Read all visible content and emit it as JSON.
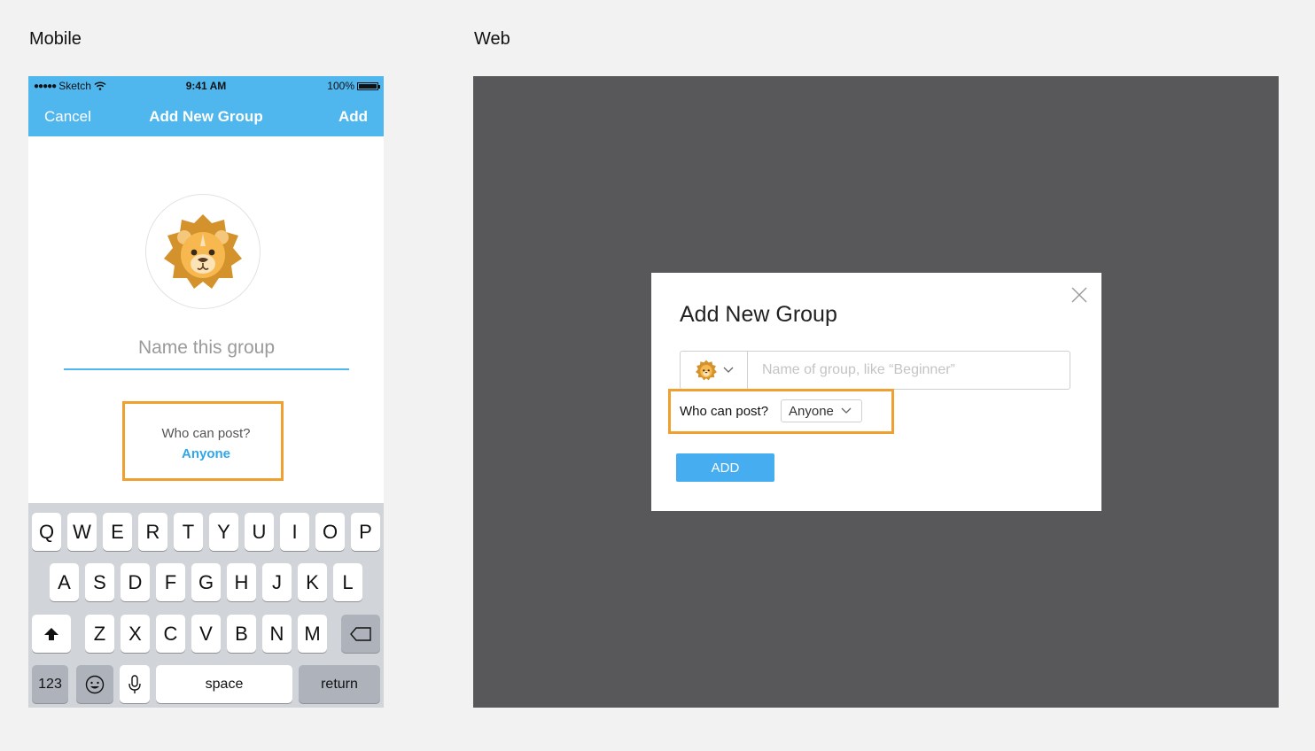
{
  "labels": {
    "mobile": "Mobile",
    "web": "Web"
  },
  "mobile": {
    "status_bar": {
      "carrier": "Sketch",
      "time": "9:41 AM",
      "battery": "100%"
    },
    "nav": {
      "cancel": "Cancel",
      "title": "Add New Group",
      "add": "Add"
    },
    "avatar_icon": "lion-emoji-icon",
    "name_placeholder": "Name this group",
    "who_can_post_label": "Who can post?",
    "who_can_post_value": "Anyone",
    "keyboard": {
      "row1": [
        "Q",
        "W",
        "E",
        "R",
        "T",
        "Y",
        "U",
        "I",
        "O",
        "P"
      ],
      "row2": [
        "A",
        "S",
        "D",
        "F",
        "G",
        "H",
        "J",
        "K",
        "L"
      ],
      "row3": [
        "Z",
        "X",
        "C",
        "V",
        "B",
        "N",
        "M"
      ],
      "numbers": "123",
      "space": "space",
      "return": "return"
    }
  },
  "web": {
    "modal": {
      "title": "Add New Group",
      "name_placeholder": "Name of group, like “Beginner”",
      "who_can_post_label": "Who can post?",
      "who_can_post_value": "Anyone",
      "add_button": "ADD"
    }
  },
  "colors": {
    "accent_blue": "#4fb6ee",
    "highlight_orange": "#f0a030",
    "web_canvas": "#58585a"
  }
}
